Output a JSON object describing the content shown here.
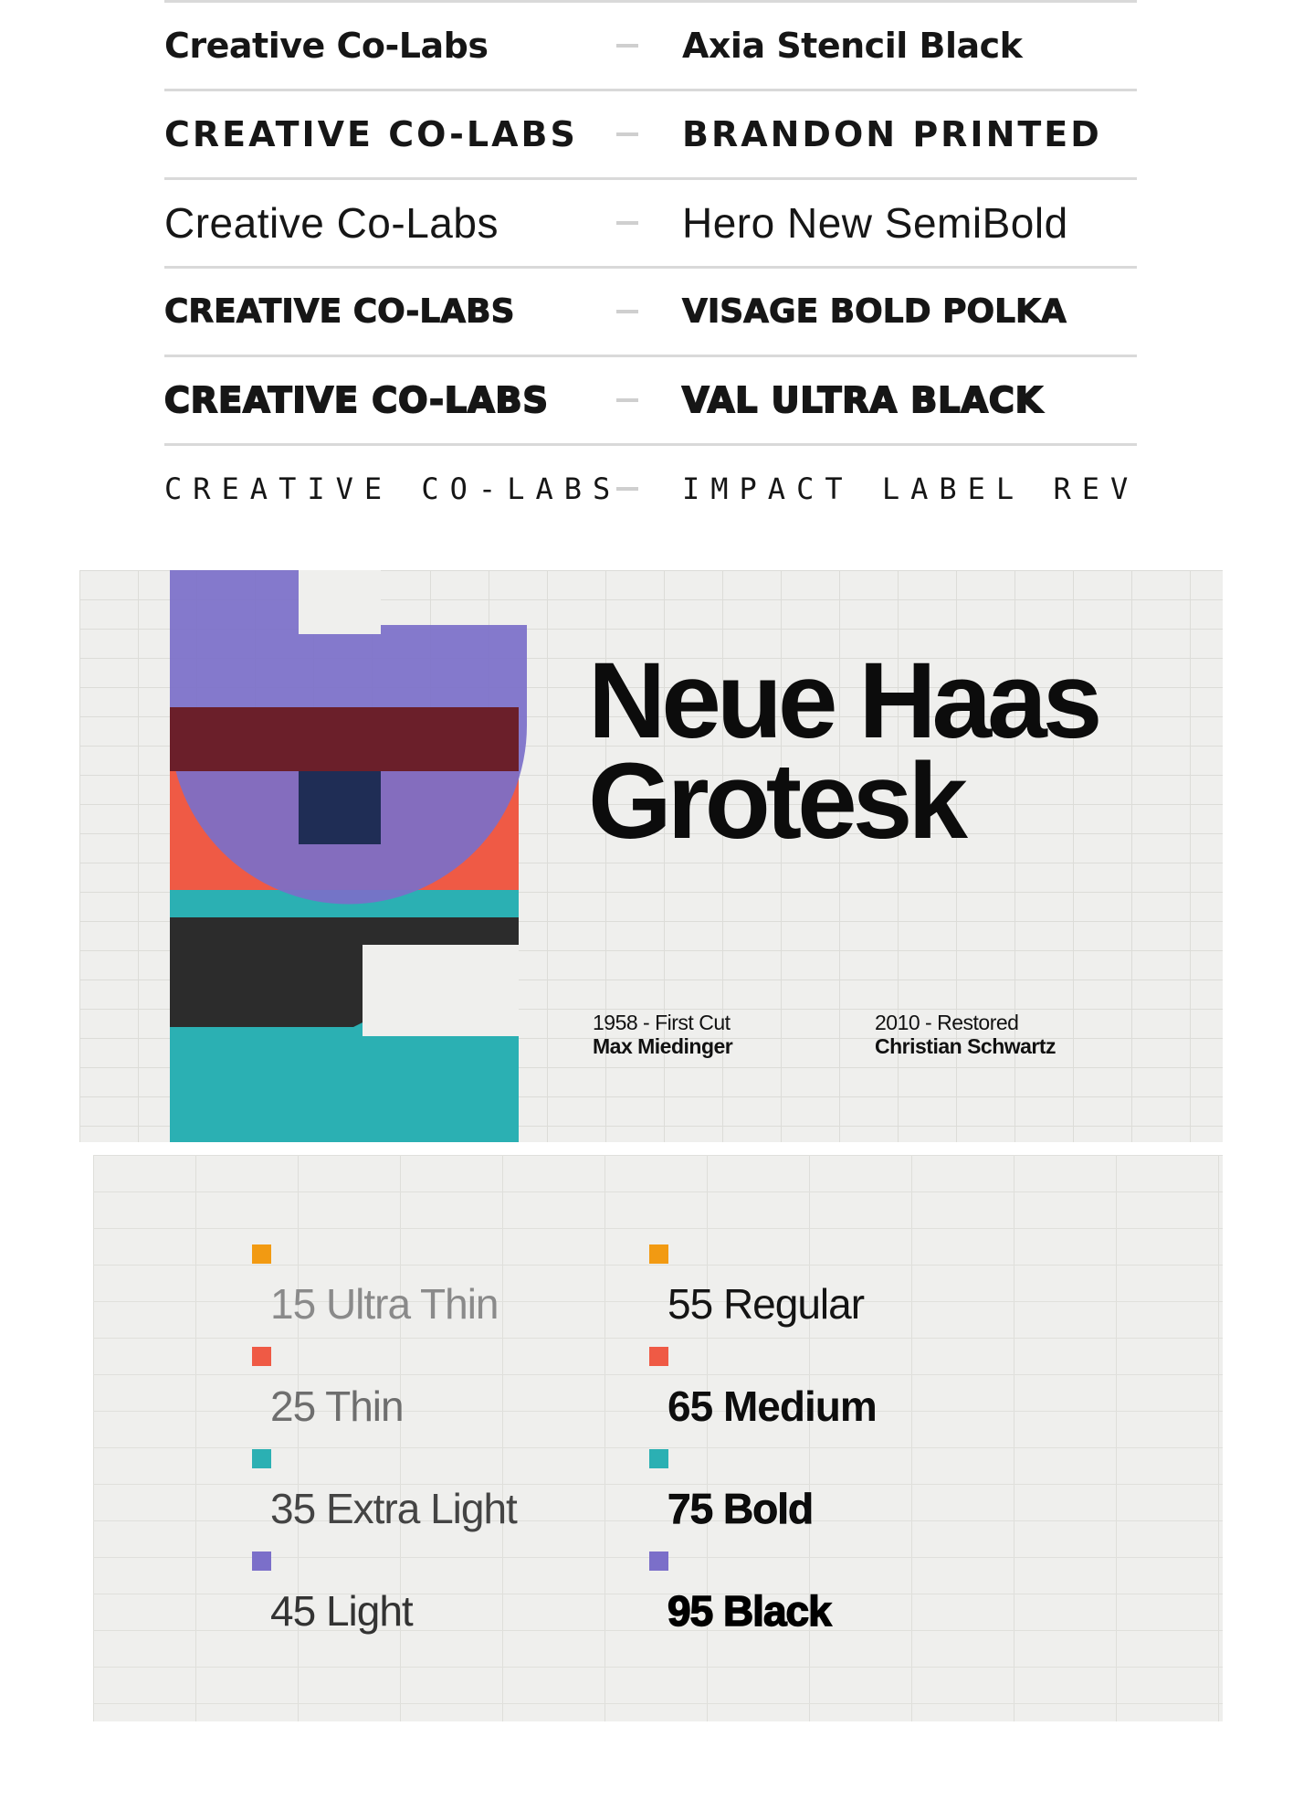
{
  "font_pairs": [
    {
      "left": "Creative Co-Labs",
      "right": "Axia Stencil Black"
    },
    {
      "left": "CREATIVE CO-LABS",
      "right": "BRANDON PRINTED"
    },
    {
      "left": "Creative Co-Labs",
      "right": "Hero New SemiBold"
    },
    {
      "left": "CREATIVE CO-LABS",
      "right": "VISAGE BOLD POLKA"
    },
    {
      "left": "CREATIVE CO-LABS",
      "right": "VAL ULTRA BLACK"
    },
    {
      "left": "CREATIVE CO-LABS",
      "right": "IMPACT LABEL REV"
    }
  ],
  "poster": {
    "title_line1": "Neue Haas",
    "title_line2": "Grotesk",
    "credits": [
      {
        "year": "1958 - First Cut",
        "name": "Max Miedinger"
      },
      {
        "year": "2010 - Restored",
        "name": "Christian Schwartz"
      }
    ],
    "colors": {
      "purple": "#7b6fc9",
      "red": "#ef5a45",
      "teal": "#2bb0b3",
      "dark": "#2c2c2c"
    }
  },
  "weights": [
    {
      "label": "15 Ultra Thin",
      "color": "#f29a12"
    },
    {
      "label": "25 Thin",
      "color": "#ef5a45"
    },
    {
      "label": "35 Extra Light",
      "color": "#2bb0b3"
    },
    {
      "label": "45 Light",
      "color": "#7b6fc9"
    },
    {
      "label": "55 Regular",
      "color": "#f29a12"
    },
    {
      "label": "65 Medium",
      "color": "#ef5a45"
    },
    {
      "label": "75 Bold",
      "color": "#2bb0b3"
    },
    {
      "label": "95 Black",
      "color": "#7b6fc9"
    }
  ]
}
